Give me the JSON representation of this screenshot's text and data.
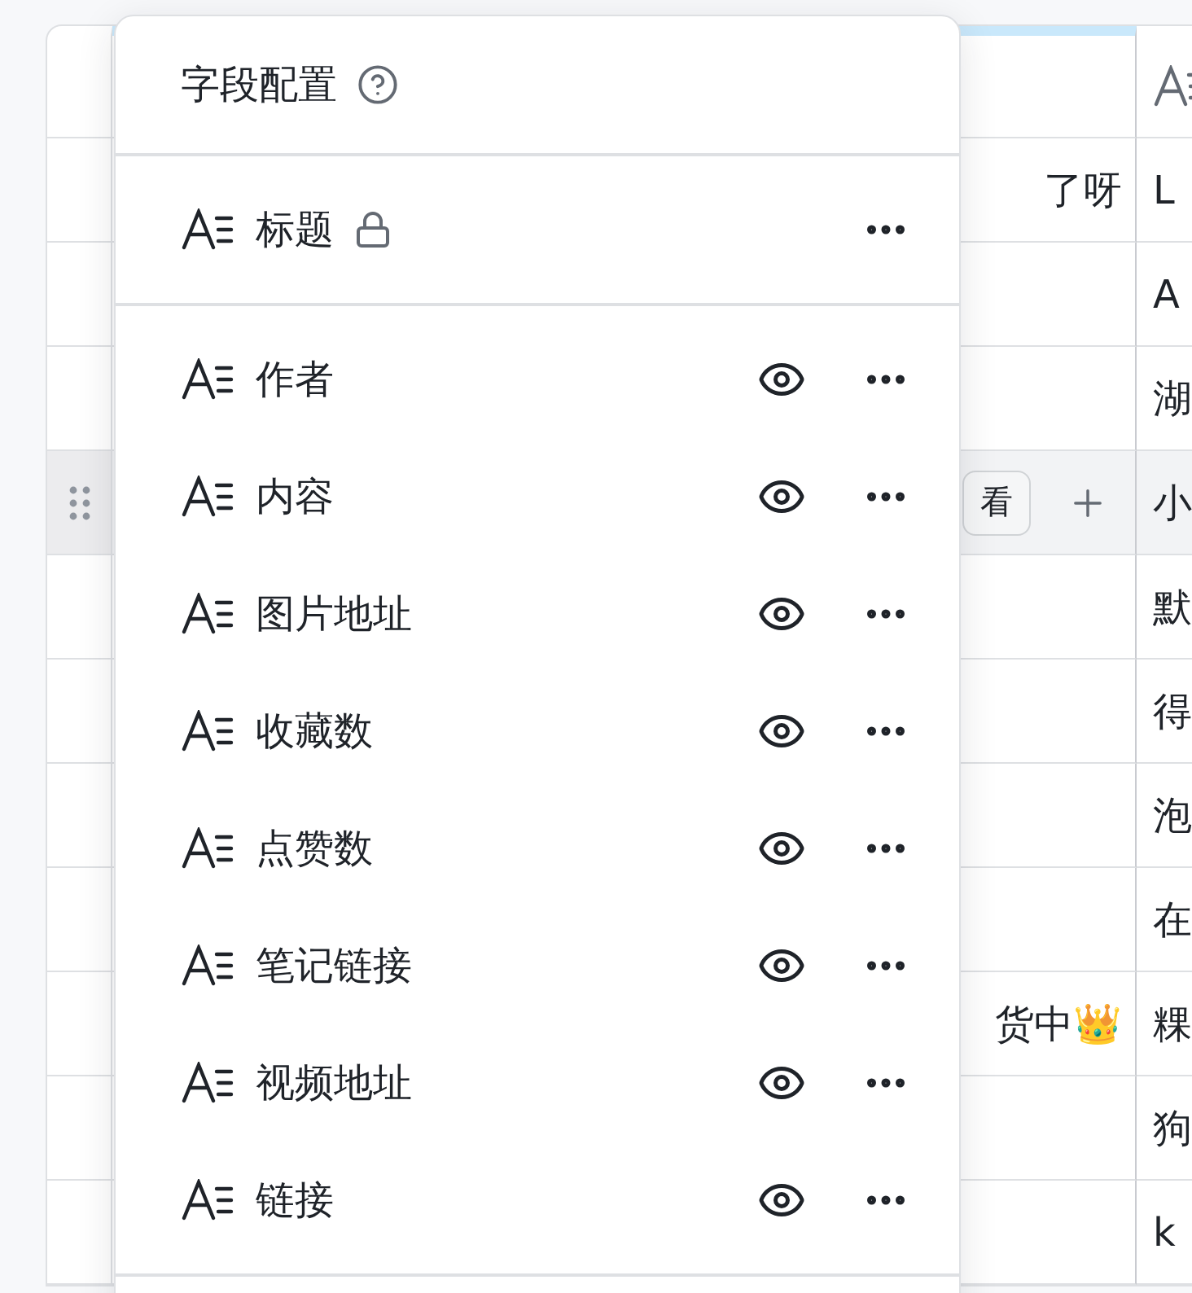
{
  "table": {
    "rows": [
      {
        "cell_1": "了呀",
        "cell_2": "L",
        "hovered": false
      },
      {
        "cell_1": "",
        "cell_2": "A",
        "hovered": false
      },
      {
        "cell_1": "",
        "cell_2": "湖",
        "hovered": false
      },
      {
        "cell_1": "",
        "cell_2": "小",
        "hovered": true,
        "view_button": "看"
      },
      {
        "cell_1": "",
        "cell_2": "默",
        "hovered": false
      },
      {
        "cell_1": "",
        "cell_2": "得",
        "hovered": false
      },
      {
        "cell_1": "",
        "cell_2": "泡",
        "hovered": false
      },
      {
        "cell_1": "",
        "cell_2": "在",
        "hovered": false
      },
      {
        "cell_1": "货中👑",
        "cell_2": "粿",
        "hovered": false
      },
      {
        "cell_1": "",
        "cell_2": "狗",
        "hovered": false
      },
      {
        "cell_1": "",
        "cell_2": "k",
        "hovered": false
      }
    ]
  },
  "field_config": {
    "title": "字段配置",
    "primary_field": {
      "name": "标题",
      "locked": true
    },
    "fields": [
      {
        "name": "作者",
        "visible": true
      },
      {
        "name": "内容",
        "visible": true
      },
      {
        "name": "图片地址",
        "visible": true
      },
      {
        "name": "收藏数",
        "visible": true
      },
      {
        "name": "点赞数",
        "visible": true
      },
      {
        "name": "笔记链接",
        "visible": true
      },
      {
        "name": "视频地址",
        "visible": true
      },
      {
        "name": "链接",
        "visible": true
      }
    ]
  }
}
